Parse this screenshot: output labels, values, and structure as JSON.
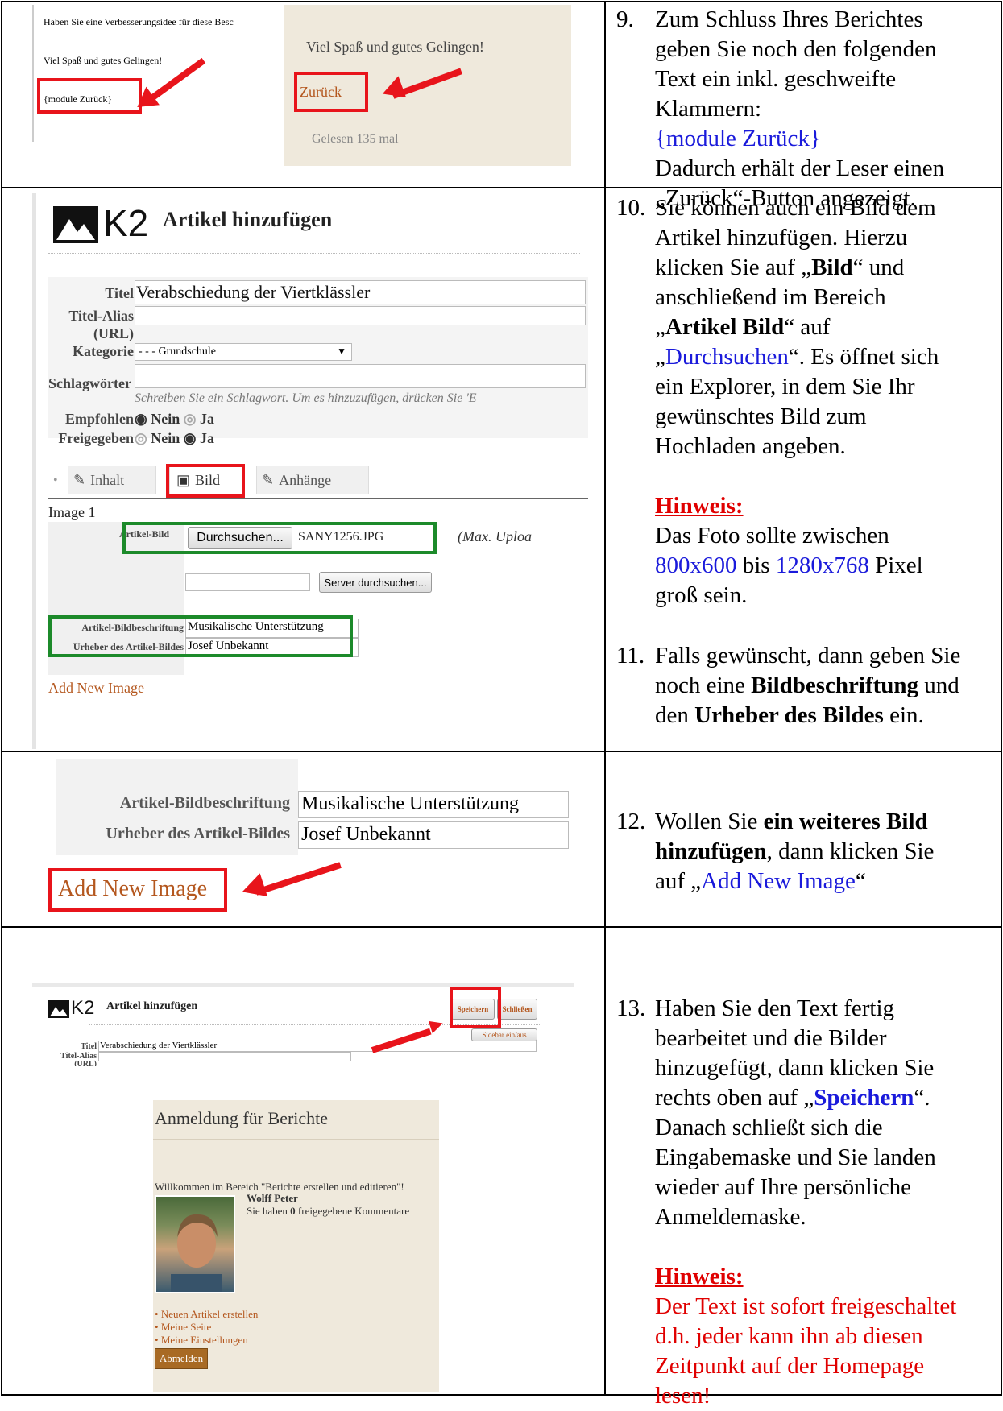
{
  "rows": [
    {
      "step": "9.",
      "text_lines": [
        "Zum Schluss Ihres Berichtes",
        "geben Sie noch den folgenden",
        "Text ein inkl. geschweifte",
        "Klammern:"
      ],
      "code": "{module Zurück}",
      "after_lines": [
        "Dadurch erhält der Leser einen",
        "„Zurück“-Button angezeigt."
      ],
      "shot_left": {
        "line1": "Haben Sie eine Verbesserungsidee für diese Besc",
        "line2": "Viel Spaß und gutes Gelingen!",
        "module": "{module Zurück}"
      },
      "shot_right": {
        "line1": "Viel Spaß und gutes Gelingen!",
        "back": "Zurück",
        "read": "Gelesen 135 mal"
      }
    },
    {
      "step": "10.",
      "p1": [
        "Sie können auch ein Bild dem",
        "Artikel hinzufügen. Hierzu"
      ],
      "p_click_pre": "klicken Sie auf „",
      "p_click_bold": "Bild",
      "p_click_post": "“ und",
      "p_area": "anschließend im Bereich",
      "p_area2_pre": "„",
      "p_area2_bold": "Artikel Bild",
      "p_area2_post": "“ auf",
      "p_browse_pre": "„",
      "p_browse_link": "Durchsuchen",
      "p_browse_post": "“. Es öffnet sich",
      "p_rest": [
        "ein Explorer, in dem Sie Ihr",
        "gewünschtes Bild zum",
        "Hochladen angeben."
      ],
      "hint_title": "Hinweis:",
      "hint_line1": "Das Foto sollte zwischen",
      "hint_size1": "800x600",
      "hint_mid": " bis ",
      "hint_size2": "1280x768",
      "hint_post": " Pixel",
      "hint_line3": "groß sein.",
      "shot": {
        "logo": "K2",
        "heading": "Artikel hinzufügen",
        "title_label": "Titel",
        "title_value": "Verabschiedung der Viertklässler",
        "alias_label": "Titel-Alias",
        "alias_label2": "(URL)",
        "category_label": "Kategorie",
        "category_value": "- - - Grundschule",
        "tags_label": "Schlagwörter",
        "tags_hint": "Schreiben Sie ein Schlagwort. Um es hinzuzufügen, drücken Sie 'E",
        "featured_label": "Empfohlen",
        "published_label": "Freigegeben",
        "no": "Nein",
        "yes": "Ja",
        "tab_content": "Inhalt",
        "tab_image": "Bild",
        "tab_attach": "Anhänge",
        "image1": "Image 1",
        "article_image_label": "Artikel-Bild",
        "browse_btn": "Durchsuchen...",
        "file_name": "SANY1256.JPG",
        "max_upload": "(Max. Uploa",
        "server_btn": "Server durchsuchen...",
        "caption_label": "Artikel-Bildbeschriftung",
        "caption_value": "Musikalische Unterstützung",
        "credit_label": "Urheber des Artikel-Bildes",
        "credit_value": "Josef Unbekannt",
        "add_new": "Add New Image"
      }
    },
    {
      "step": "11.",
      "pre": "Falls gewünscht, dann geben Sie",
      "pre2": "noch eine ",
      "bold1": "Bildbeschriftung",
      "post2": " und",
      "pre3": "den ",
      "bold2": "Urheber des Bildes",
      "post3": " ein."
    },
    {
      "step": "12.",
      "pre": "Wollen Sie ",
      "bold1": "ein weiteres Bild",
      "bold2": "hinzufügen",
      "post2": ", dann klicken Sie",
      "pre3": "auf „",
      "link": "Add New Image",
      "post3": "“",
      "shot": {
        "caption_label": "Artikel-Bildbeschriftung",
        "caption_value": "Musikalische Unterstützung",
        "credit_label": "Urheber des Artikel-Bildes",
        "credit_value": "Josef Unbekannt",
        "add_new": "Add New Image"
      }
    },
    {
      "step": "13.",
      "lines": [
        "Haben Sie den Text fertig",
        "bearbeitet und die Bilder",
        "hinzugefügt, dann klicken Sie"
      ],
      "save_pre": "rechts oben auf „",
      "save_bold": "Speichern",
      "save_post": "“.",
      "lines2": [
        "Danach schließt sich die",
        "Eingabemaske und Sie landen",
        "wieder auf Ihre persönliche",
        "Anmeldemaske."
      ],
      "hint_title": "Hinweis:",
      "hint_lines": [
        "Der Text ist sofort freigeschaltet",
        "d.h. jeder kann ihn ab diesen",
        "Zeitpunkt auf der Homepage",
        "lesen!"
      ],
      "shot_top": {
        "logo": "K2",
        "heading": "Artikel hinzufügen",
        "save": "Speichern",
        "close": "Schließen",
        "sidebar": "Sidebar ein/aus",
        "title_label": "Titel",
        "title_value": "Verabschiedung der Viertklässler",
        "alias_label": "Titel-Alias",
        "alias_label2": "(URL)"
      },
      "shot_bottom": {
        "heading": "Anmeldung für Berichte",
        "welcome": "Willkommen im Bereich \"Berichte erstellen und editieren\"!",
        "user": "Wolff Peter",
        "comments_pre": "Sie haben ",
        "comments_count": "0",
        "comments_post": " freigegebene Kommentare",
        "links": [
          "Neuen Artikel erstellen",
          "Meine Seite",
          "Meine Einstellungen"
        ],
        "logout": "Abmelden"
      }
    }
  ]
}
